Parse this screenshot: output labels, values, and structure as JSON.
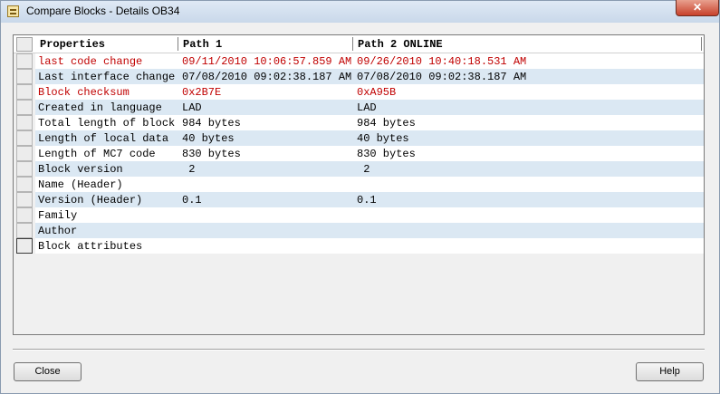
{
  "window": {
    "title": "Compare Blocks - Details OB34",
    "close_label": "✕"
  },
  "table": {
    "headers": [
      "Properties",
      "Path 1",
      "Path 2 ONLINE"
    ],
    "rows": [
      {
        "property": "last code change",
        "path1": "09/11/2010 10:06:57.859 AM",
        "path2": "09/26/2010 10:40:18.531 AM",
        "differs": true
      },
      {
        "property": "Last interface change",
        "path1": "07/08/2010 09:02:38.187 AM",
        "path2": "07/08/2010 09:02:38.187 AM",
        "differs": false
      },
      {
        "property": "Block checksum",
        "path1": "0x2B7E",
        "path2": "0xA95B",
        "differs": true
      },
      {
        "property": "Created in language",
        "path1": "LAD",
        "path2": "LAD",
        "differs": false
      },
      {
        "property": "Total length of block",
        "path1": "984 bytes",
        "path2": "984 bytes",
        "differs": false
      },
      {
        "property": "Length of local data",
        "path1": "40 bytes",
        "path2": "40 bytes",
        "differs": false
      },
      {
        "property": "Length of MC7 code",
        "path1": "830 bytes",
        "path2": "830 bytes",
        "differs": false
      },
      {
        "property": "Block version",
        "path1": " 2",
        "path2": " 2",
        "differs": false
      },
      {
        "property": "Name (Header)",
        "path1": "",
        "path2": "",
        "differs": false
      },
      {
        "property": "Version (Header)",
        "path1": "0.1",
        "path2": "0.1",
        "differs": false
      },
      {
        "property": "Family",
        "path1": "",
        "path2": "",
        "differs": false
      },
      {
        "property": "Author",
        "path1": "",
        "path2": "",
        "differs": false
      },
      {
        "property": "Block attributes",
        "path1": "",
        "path2": "",
        "differs": false
      }
    ]
  },
  "buttons": {
    "close": "Close",
    "help": "Help"
  },
  "colors": {
    "diff_text": "#c00000",
    "stripe": "#dbe8f3"
  }
}
